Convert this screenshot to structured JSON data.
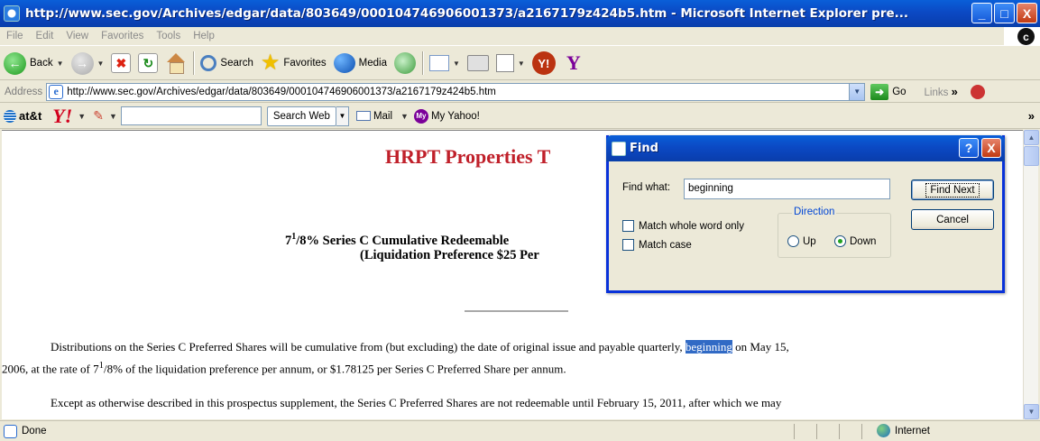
{
  "window": {
    "title": "http://www.sec.gov/Archives/edgar/data/803649/000104746906001373/a2167179z424b5.htm - Microsoft Internet Explorer pre...",
    "min": "_",
    "max": "□",
    "close": "X"
  },
  "menu": [
    "File",
    "Edit",
    "View",
    "Favorites",
    "Tools",
    "Help"
  ],
  "menu_logo": "c",
  "toolbar": {
    "back": "Back",
    "search": "Search",
    "favorites": "Favorites",
    "media": "Media"
  },
  "address": {
    "label": "Address",
    "url": "http://www.sec.gov/Archives/edgar/data/803649/000104746906001373/a2167179z424b5.htm",
    "go": "Go",
    "links": "Links"
  },
  "yahoo_toolbar": {
    "att": "at&t",
    "logo": "Y!",
    "search_button": "Search Web",
    "mail": "Mail",
    "my_yahoo": "My Yahoo!",
    "more": "»"
  },
  "document": {
    "title": "HRPT Properties T",
    "line1_sup": "1",
    "line1_rest": "/8% Series C Cumulative Redeemable",
    "line1_lead": "7",
    "line2": "(Liquidation Preference $25 Per",
    "para1_before": "Distributions on the Series C Preferred Shares will be cumulative from (but excluding) the date of original issue and payable quarterly, ",
    "para1_highlight": "beginning",
    "para1_after": " on May 15,",
    "para1_line2_a": "2006, at the rate of 7",
    "para1_line2_sup": "1",
    "para1_line2_b": "/8% of the liquidation preference per annum, or $1.78125 per Series C Preferred Share per annum.",
    "para2": "Except as otherwise described in this prospectus supplement, the Series C Preferred Shares are not redeemable until February 15, 2011, after which we may"
  },
  "find_dialog": {
    "title": "Find",
    "help": "?",
    "close": "X",
    "find_what_label": "Find what:",
    "find_what_value": "beginning",
    "match_whole_word": "Match whole word only",
    "match_case": "Match case",
    "direction_label": "Direction",
    "up": "Up",
    "down": "Down",
    "direction_selected": "Down",
    "find_next": "Find Next",
    "cancel": "Cancel"
  },
  "status": {
    "text": "Done",
    "zone": "Internet"
  }
}
